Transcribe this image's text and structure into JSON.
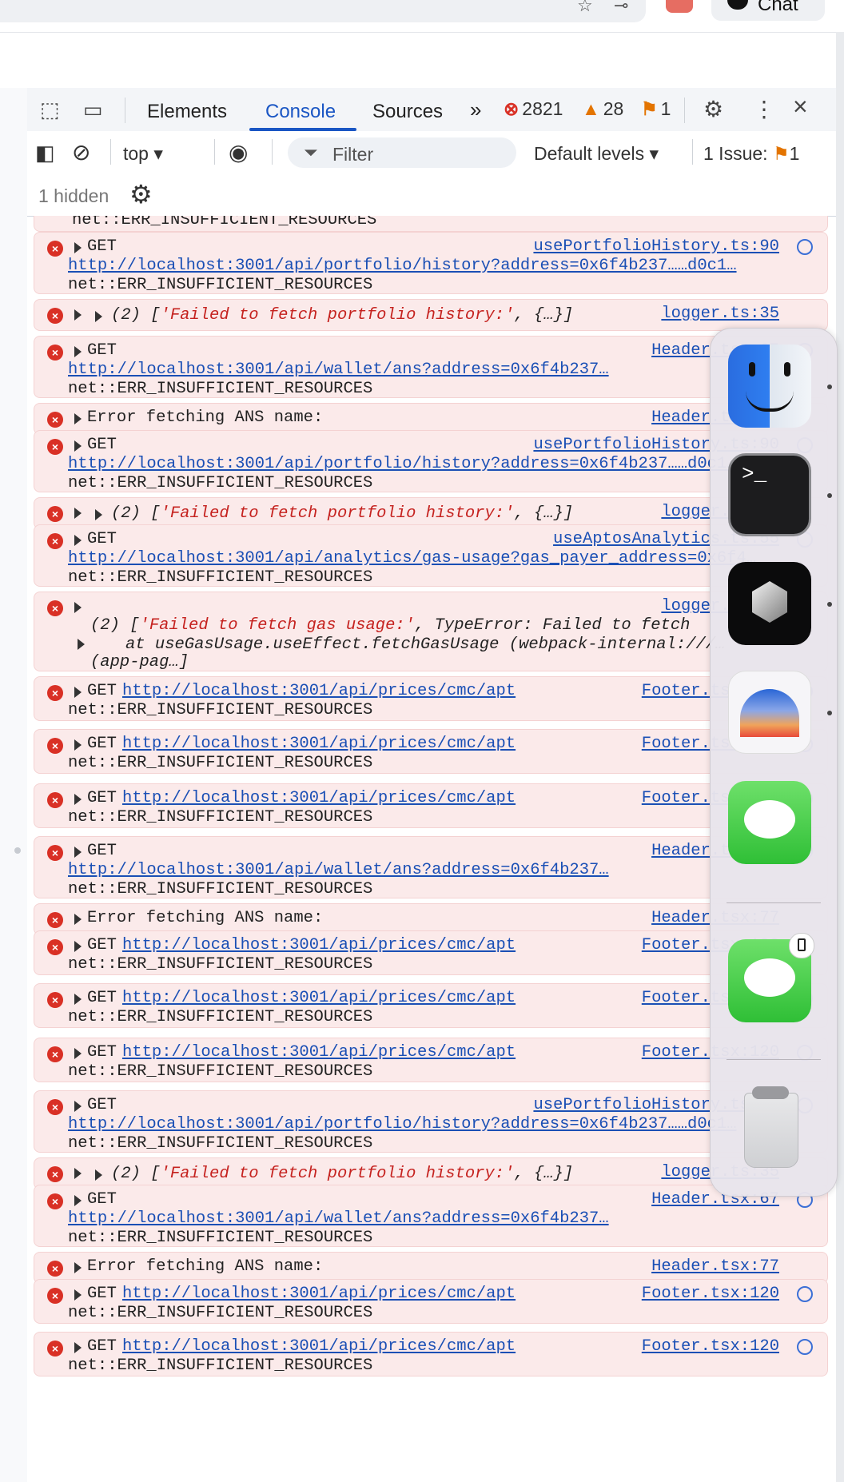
{
  "chrome": {
    "chat_label": "Chat"
  },
  "devtools": {
    "tabs": [
      "Elements",
      "Console",
      "Sources"
    ],
    "more_tabs": "»",
    "errors_count": "2821",
    "warnings_count": "28",
    "issues_count": "1",
    "context": "top",
    "filter_placeholder": "Filter",
    "levels": "Default levels",
    "issues_label": "1 Issue:",
    "issues_badge": "1",
    "hidden_label": "1 hidden",
    "close_symbol": "×",
    "more_symbol": "⋮"
  },
  "console": {
    "top_partial": "net::ERR_INSUFFICIENT_RESOURCES",
    "entries": [
      {
        "l1": "GET",
        "src": "usePortfolioHistory.ts:90",
        "l2": "http://localhost:3001/api/portfolio/history?address=0x6f4b237……d0c1…",
        "l3": "net::ERR_INSUFFICIENT_RESOURCES"
      },
      {
        "l1": "(2) ['Failed to fetch portfolio history:', {…}]",
        "src": "logger.ts:35"
      },
      {
        "l1": "GET",
        "src": "Header.tsx:67",
        "l2": "http://localhost:3001/api/wallet/ans?address=0x6f4b237…",
        "l3": "net::ERR_INSUFFICIENT_RESOURCES"
      },
      {
        "l1": "Error fetching ANS name:",
        "src": "Header.tsx:77"
      },
      {
        "l1": "GET",
        "src": "usePortfolioHistory.ts:90",
        "l2": "http://localhost:3001/api/portfolio/history?address=0x6f4b237……d0c1…",
        "l3": "net::ERR_INSUFFICIENT_RESOURCES"
      },
      {
        "l1": "(2) ['Failed to fetch portfolio history:', {…}]",
        "src": "logger.ts:35"
      },
      {
        "l1": "GET",
        "src": "useAptosAnalytics.ts:55",
        "l2": "http://localhost:3001/api/analytics/gas-usage?gas_payer_address=0x6f4…",
        "l3": "net::ERR_INSUFFICIENT_RESOURCES"
      },
      {
        "l1": "(2) ['Failed to fetch gas usage:', TypeError: Failed to fetch",
        "l2": "at useGasUsage.useEffect.fetchGasUsage (webpack-internal:///…",
        "l3": "(app-pag…]",
        "src": "logger.ts:35"
      },
      {
        "l1": "GET",
        "url": "http://localhost:3001/api/prices/cmc/apt",
        "src": "Footer.tsx:120",
        "l2": "net::ERR_INSUFFICIENT_RESOURCES"
      },
      {
        "l1": "GET",
        "url": "http://localhost:3001/api/prices/cmc/apt",
        "src": "Footer.tsx:120",
        "l2": "net::ERR_INSUFFICIENT_RESOURCES"
      },
      {
        "l1": "GET",
        "url": "http://localhost:3001/api/prices/cmc/apt",
        "src": "Footer.tsx:120",
        "l2": "net::ERR_INSUFFICIENT_RESOURCES"
      },
      {
        "l1": "GET",
        "src": "Header.tsx:67",
        "l2": "http://localhost:3001/api/wallet/ans?address=0x6f4b237…",
        "l3": "net::ERR_INSUFFICIENT_RESOURCES"
      },
      {
        "l1": "Error fetching ANS name:",
        "src": "Header.tsx:77"
      },
      {
        "l1": "GET",
        "url": "http://localhost:3001/api/prices/cmc/apt",
        "src": "Footer.tsx:120",
        "l2": "net::ERR_INSUFFICIENT_RESOURCES"
      },
      {
        "l1": "GET",
        "url": "http://localhost:3001/api/prices/cmc/apt",
        "src": "Footer.tsx:120",
        "l2": "net::ERR_INSUFFICIENT_RESOURCES"
      },
      {
        "l1": "GET",
        "url": "http://localhost:3001/api/prices/cmc/apt",
        "src": "Footer.tsx:120",
        "l2": "net::ERR_INSUFFICIENT_RESOURCES"
      },
      {
        "l1": "GET",
        "src": "usePortfolioHistory.ts:90",
        "l2": "http://localhost:3001/api/portfolio/history?address=0x6f4b237……d0c1…",
        "l3": "net::ERR_INSUFFICIENT_RESOURCES"
      },
      {
        "l1": "(2) ['Failed to fetch portfolio history:', {…}]",
        "src": "logger.ts:35"
      },
      {
        "l1": "GET",
        "src": "Header.tsx:67",
        "l2": "http://localhost:3001/api/wallet/ans?address=0x6f4b237…",
        "l3": "net::ERR_INSUFFICIENT_RESOURCES"
      },
      {
        "l1": "Error fetching ANS name:",
        "src": "Header.tsx:77"
      },
      {
        "l1": "GET",
        "url": "http://localhost:3001/api/prices/cmc/apt",
        "src": "Footer.tsx:120",
        "l2": "net::ERR_INSUFFICIENT_RESOURCES"
      },
      {
        "l1": "GET",
        "url": "http://localhost:3001/api/prices/cmc/apt",
        "src": "Footer.tsx:120",
        "l2": "net::ERR_INSUFFICIENT_RESOURCES"
      }
    ]
  },
  "dock": {
    "apps": [
      "finder-icon",
      "terminal-icon",
      "cube-app-icon",
      "arc-app-icon",
      "messages-icon",
      "messages-phone-icon",
      "trash-icon"
    ]
  }
}
